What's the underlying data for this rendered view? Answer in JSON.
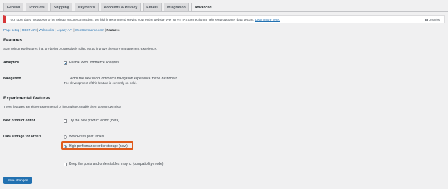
{
  "tabs": [
    {
      "label": "General"
    },
    {
      "label": "Products"
    },
    {
      "label": "Shipping"
    },
    {
      "label": "Payments"
    },
    {
      "label": "Accounts & Privacy"
    },
    {
      "label": "Emails"
    },
    {
      "label": "Integration"
    },
    {
      "label": "Advanced"
    }
  ],
  "notice": {
    "text": "Your store does not appear to be using a secure connection. We highly recommend serving your entire website over an HTTPS connection to help keep customer data secure.",
    "link": "Learn more here.",
    "dismiss": "Dismiss"
  },
  "subsub": {
    "items": [
      "Page setup",
      "REST API",
      "Webhooks",
      "Legacy API",
      "WooCommerce.com",
      "Features"
    ],
    "separator": "|"
  },
  "features": {
    "title": "Features",
    "description": "Start using new features that are being progressively rolled out to improve the store management experience.",
    "analytics": {
      "label": "Analytics",
      "option": "Enable WooCommerce Analytics",
      "checked": true
    },
    "navigation": {
      "label": "Navigation",
      "option": "Adds the new WooCommerce navigation experience to the dashboard",
      "note": "The development of this feature is currently on hold."
    }
  },
  "experimental": {
    "title": "Experimental features",
    "description": "These features are either experimental or incomplete, enable them at your own risk!",
    "product_editor": {
      "label": "New product editor",
      "option": "Try the new product editor (Beta)",
      "checked": false
    },
    "data_storage": {
      "label": "Data storage for orders",
      "options": [
        {
          "label": "WordPress post tables",
          "checked": false
        },
        {
          "label": "High performance order storage (new)",
          "checked": true
        }
      ],
      "sync": "Keep the posts and orders tables in sync (compatibility mode)."
    }
  },
  "save_label": "Save changes",
  "colors": {
    "accent": "#2271b1",
    "highlight": "#e05a1b",
    "notice_error": "#d63638"
  }
}
